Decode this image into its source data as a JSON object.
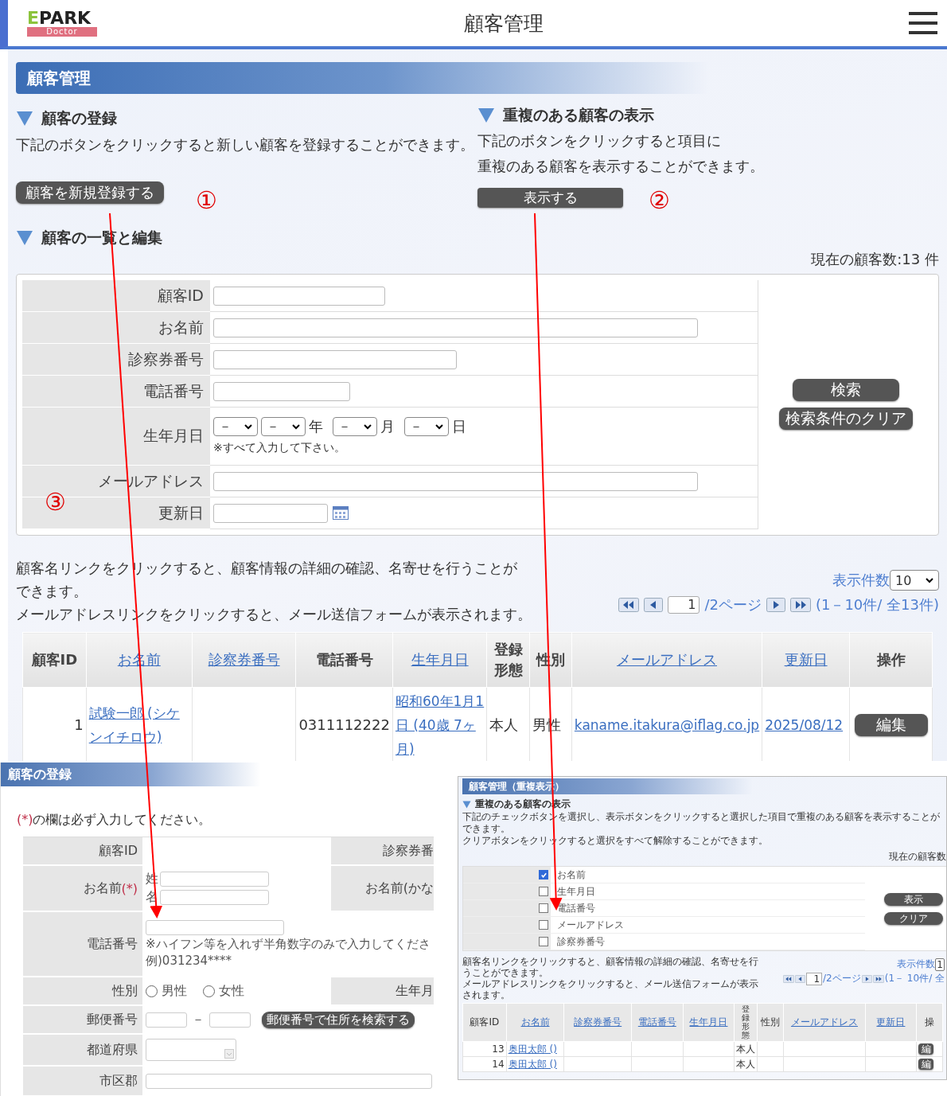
{
  "header": {
    "logo": {
      "brand": "EPARK",
      "sub": "Doctor"
    },
    "title": "顧客管理"
  },
  "page_heading": "顧客管理",
  "register": {
    "heading": "顧客の登録",
    "description": "下記のボタンをクリックすると新しい顧客を登録することができます。",
    "button": "顧客を新規登録する"
  },
  "duplicates": {
    "heading": "重複のある顧客の表示",
    "description": [
      "下記のボタンをクリックすると項目に",
      "重複のある顧客を表示することができます。"
    ],
    "button": "表示する"
  },
  "list": {
    "heading": "顧客の一覧と編集",
    "count": "現在の顧客数:13 件"
  },
  "search": {
    "fields": [
      {
        "label": "顧客ID",
        "kind": "text"
      },
      {
        "label": "お名前",
        "kind": "text"
      },
      {
        "label": "診察券番号",
        "kind": "text"
      },
      {
        "label": "電話番号",
        "kind": "text"
      },
      {
        "label": "生年月日",
        "kind": "date_select",
        "selects": [
          {
            "value": "－"
          },
          {
            "value": "－",
            "unit": "年"
          },
          {
            "value": "－",
            "unit": "月"
          },
          {
            "value": "－",
            "unit": "日"
          }
        ],
        "note": "※すべて入力して下さい。"
      },
      {
        "label": "メールアドレス",
        "kind": "text"
      },
      {
        "label": "更新日",
        "kind": "date"
      }
    ],
    "buttons": [
      "検索",
      "検索条件のクリア"
    ]
  },
  "info": [
    "顧客名リンクをクリックすると、顧客情報の詳細の確認、名寄せを行うことができます。",
    "メールアドレスリンクをクリックすると、メール送信フォームが表示されます。"
  ],
  "pagination": {
    "per_page_label": "表示件数",
    "per_page": "10",
    "page": "1",
    "pages": "/2ページ",
    "range": "(1－10件/ 全13件)"
  },
  "table": {
    "columns": [
      {
        "label": "顧客ID",
        "kind": "text"
      },
      {
        "label": "お名前",
        "kind": "link"
      },
      {
        "label": "診察券番号",
        "kind": "link"
      },
      {
        "label": "電話番号",
        "kind": "text"
      },
      {
        "label": "生年月日",
        "kind": "link"
      },
      {
        "label": "登録形態",
        "kind": "text"
      },
      {
        "label": "性別",
        "kind": "text"
      },
      {
        "label": "メールアドレス",
        "kind": "link"
      },
      {
        "label": "更新日",
        "kind": "link"
      },
      {
        "label": "操作",
        "kind": "text"
      }
    ],
    "rows": [
      {
        "cells": [
          "1",
          "試験一郎 (シケンイチロウ)",
          "",
          "0311112222",
          "昭和60年1月1日 (40歳 7ヶ月)",
          "本人",
          "男性",
          "kaname.itakura@iflag.co.jp",
          "2025/08/12"
        ],
        "action": "編集"
      }
    ]
  },
  "register_form": {
    "title": "顧客の登録",
    "required_mark": "(*)",
    "required_note": "の欄は必ず入力してください。",
    "rows": [
      {
        "label": "顧客ID",
        "required": false,
        "kind": "empty",
        "side_label": "診察券番"
      },
      {
        "label": "お名前",
        "required": true,
        "kind": "name",
        "parts": [
          "姓",
          "名"
        ],
        "side_label": "お名前(かな"
      },
      {
        "label": "電話番号",
        "required": false,
        "kind": "phone",
        "note": "※ハイフン等を入れず半角数字のみで入力してくださ",
        "example": "例)031234****"
      },
      {
        "label": "性別",
        "required": false,
        "kind": "radio",
        "options": [
          {
            "label": "男性",
            "selected": false
          },
          {
            "label": "女性",
            "selected": false
          }
        ],
        "side_label": "生年月"
      },
      {
        "label": "郵便番号",
        "required": false,
        "kind": "postal",
        "separator": "－",
        "button": "郵便番号で住所を検索する"
      },
      {
        "label": "都道府県",
        "required": false,
        "kind": "select"
      },
      {
        "label": "市区郡",
        "required": false,
        "kind": "text"
      }
    ]
  },
  "duplicate_view": {
    "title": "顧客管理（重複表示）",
    "heading": "重複のある顧客の表示",
    "description": [
      "下記のチェックボタンを選択し、表示ボタンをクリックすると選択した項目で重複のある顧客を表示することができます。",
      "クリアボタンをクリックすると選択をすべて解除することができます。"
    ],
    "count": "現在の顧客数",
    "options": [
      {
        "label": "お名前",
        "checked": true
      },
      {
        "label": "生年月日",
        "checked": false
      },
      {
        "label": "電話番号",
        "checked": false
      },
      {
        "label": "メールアドレス",
        "checked": false
      },
      {
        "label": "診察券番号",
        "checked": false
      }
    ],
    "buttons": [
      "表示",
      "クリア"
    ],
    "info": [
      "顧客名リンクをクリックすると、顧客情報の詳細の確認、名寄せを行うことができます。",
      "メールアドレスリンクをクリックすると、メール送信フォームが表示されます。"
    ],
    "pagination": {
      "per_page_label": "表示件数",
      "per_page": "1",
      "page": "1",
      "pages": "/2ページ",
      "range": "(1－ 10件/ 全"
    },
    "table": {
      "columns": [
        {
          "label": "顧客ID",
          "kind": "text"
        },
        {
          "label": "お名前",
          "kind": "link"
        },
        {
          "label": "診察券番号",
          "kind": "link"
        },
        {
          "label": "電話番号",
          "kind": "link"
        },
        {
          "label": "生年月日",
          "kind": "link"
        },
        {
          "label": "登録形態",
          "kind": "text"
        },
        {
          "label": "性別",
          "kind": "text"
        },
        {
          "label": "メールアドレス",
          "kind": "link"
        },
        {
          "label": "更新日",
          "kind": "link"
        },
        {
          "label": "操",
          "kind": "text"
        }
      ],
      "rows": [
        {
          "cells": [
            "13",
            "奥田太郎 ()",
            "",
            "",
            "",
            "本人",
            "",
            "",
            ""
          ],
          "action": "編"
        },
        {
          "cells": [
            "14",
            "奥田太郎 ()",
            "",
            "",
            "",
            "本人",
            "",
            "",
            ""
          ],
          "action": "編"
        }
      ]
    }
  },
  "annotations": [
    {
      "label": "①"
    },
    {
      "label": "②"
    },
    {
      "label": "③"
    }
  ]
}
